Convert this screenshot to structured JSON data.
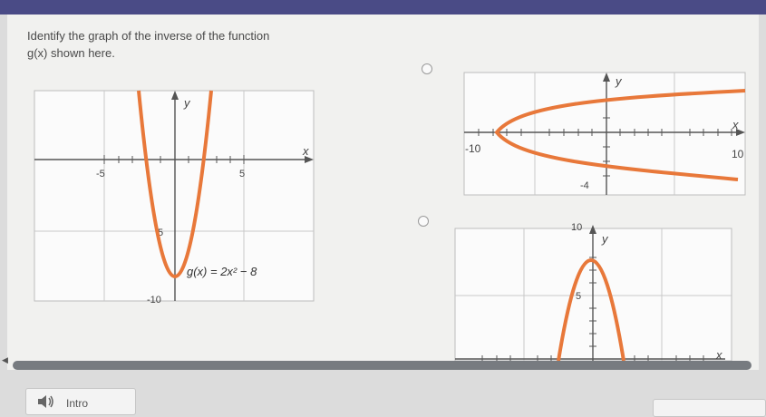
{
  "question": {
    "line1": "Identify the graph of the inverse of the function",
    "line2": "g(x) shown here."
  },
  "main_graph": {
    "function_label": "g(x) = 2x² − 8",
    "axis_x": "x",
    "axis_y": "y",
    "ticks": {
      "x_neg": "-5",
      "x_pos": "5",
      "y_pos": "5",
      "y_neg": "-10"
    }
  },
  "option_a": {
    "axis_x": "x",
    "axis_y": "y",
    "ticks": {
      "x_neg": "-10",
      "x_pos": "10",
      "y_neg": "-4"
    }
  },
  "option_b": {
    "axis_x": "x",
    "axis_y": "y",
    "ticks": {
      "y_top": "10",
      "y_mid": "5"
    }
  },
  "footer": {
    "intro_label": "Intro"
  },
  "colors": {
    "curve": "#e8783a",
    "header": "#4a4b86",
    "axis": "#555555",
    "grid": "#c8c8c8"
  }
}
